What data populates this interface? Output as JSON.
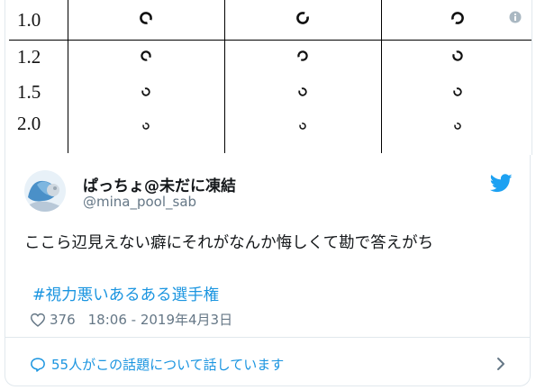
{
  "chart": {
    "rows": [
      {
        "label": "1.0",
        "symbols": [
          "ring-gap-bottom",
          "ring-gap-right",
          "ring-gap-left"
        ]
      },
      {
        "label": "1.2",
        "symbols": [
          "ring-gap-bottom",
          "ring-gap-left",
          "ring-gap-top"
        ]
      },
      {
        "label": "1.5",
        "symbols": [
          "ring-gap-top",
          "ring-gap-top",
          "ring-gap-top"
        ]
      },
      {
        "label": "2.0",
        "symbols": [
          "ring-gap-top",
          "ring-gap-top",
          "ring-gap-top"
        ]
      }
    ],
    "info_icon": "info-icon"
  },
  "tweet": {
    "display_name": "ぱっちょ@未だに凍結",
    "handle": "@mina_pool_sab",
    "text": "ここら辺見えない癖にそれがなんか悔しくて勘で答えがち",
    "hashtag": "#視力悪いあるある選手権",
    "likes": "376",
    "time": "18:06 - 2019年4月3日",
    "conversation": "55人がこの話題について話しています",
    "brand_color": "#1da1f2",
    "link_color": "#1b95e0"
  }
}
